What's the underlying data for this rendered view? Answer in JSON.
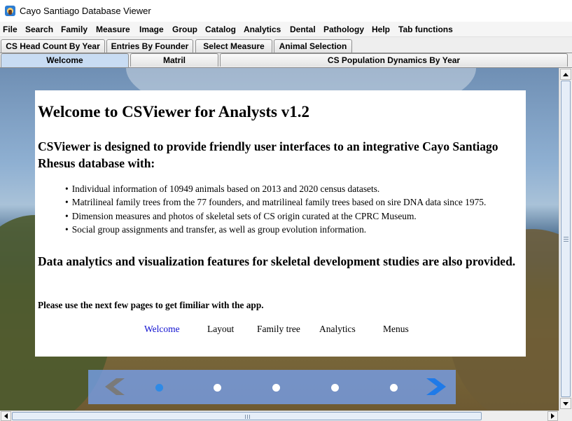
{
  "window": {
    "title": "Cayo Santiago Database Viewer"
  },
  "menubar": {
    "items": [
      "File",
      "Search",
      "Family",
      "Measure",
      "Image",
      "Group",
      "Catalog",
      "Analytics",
      "Dental",
      "Pathology",
      "Help",
      "Tab functions"
    ]
  },
  "tabs_row1": [
    "CS Head Count By Year",
    "Entries By Founder",
    "Select Measure",
    "Animal Selection"
  ],
  "tabs_row2": [
    "Welcome",
    "Matril",
    "CS Population Dynamics By Year"
  ],
  "welcome": {
    "heading": "Welcome to CSViewer for Analysts v1.2",
    "intro": "CSViewer is designed to provide friendly user interfaces to an integrative Cayo Santiago Rhesus database with:",
    "bullets": [
      "Individual information of 10949 animals based on 2013 and 2020 census datasets.",
      "Matrilineal family trees from the 77 founders, and matrilineal family trees based on sire DNA data since 1975.",
      "Dimension measures and photos of skeletal sets of CS origin curated at the CPRC Museum.",
      "Social group assignments and transfer, as well as group evolution information."
    ],
    "features": "Data analytics and visualization features for skeletal development studies are also provided.",
    "note": "Please use the next few pages to get fimiliar with the app.",
    "links": [
      "Welcome",
      "Layout",
      "Family tree",
      "Analytics",
      "Menus"
    ],
    "active_link": "Welcome"
  },
  "carousel": {
    "page_count": 5,
    "current_page": 1,
    "accent_color": "#2e8ae6"
  }
}
